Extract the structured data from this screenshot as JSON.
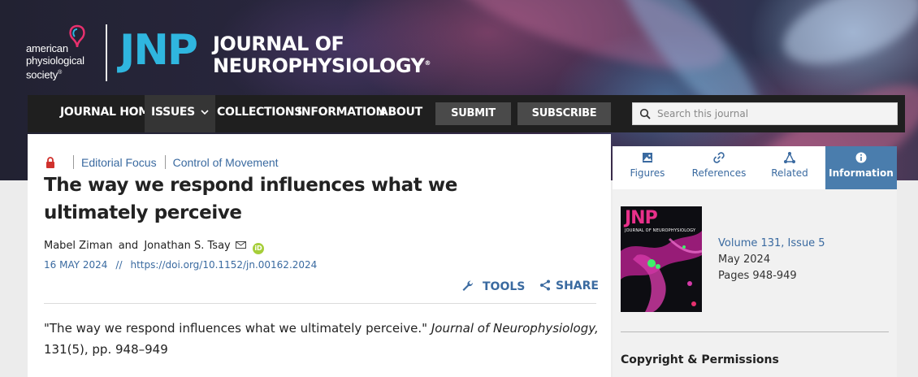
{
  "brand": {
    "aps_lines": [
      "american",
      "physiological",
      "society"
    ],
    "aps_trademark": "®",
    "jnp_abbrev": "JNP",
    "journal_name_line1": "JOURNAL OF",
    "journal_name_line2": "NEUROPHYSIOLOGY",
    "journal_name_trademark": "®"
  },
  "nav": {
    "items": [
      {
        "label": "JOURNAL HOME"
      },
      {
        "label": "ISSUES"
      },
      {
        "label": "COLLECTIONS"
      },
      {
        "label": "INFORMATION"
      },
      {
        "label": "ABOUT"
      }
    ],
    "submit_label": "SUBMIT",
    "subscribe_label": "SUBSCRIBE",
    "search_placeholder": "Search this journal"
  },
  "article": {
    "breadcrumb": [
      "Editorial Focus",
      "Control of Movement"
    ],
    "title": "The way we respond influences what we ultimately perceive",
    "authors": [
      "Mabel Ziman",
      "Jonathan S. Tsay"
    ],
    "and_text": "and",
    "orcid_text": "iD",
    "date": "16 MAY 2024",
    "date_sep": "//",
    "doi": "https://doi.org/10.1152/jn.00162.2024",
    "tools_label": "TOOLS",
    "share_label": "SHARE",
    "citation_quote": "\"The way we respond influences what we ultimately perceive.\"",
    "citation_journal": "Journal of Neurophysiology,",
    "citation_details": "131(5), pp. 948–949"
  },
  "sidebar": {
    "tabs": [
      {
        "label": "Figures",
        "icon": "image-icon"
      },
      {
        "label": "References",
        "icon": "link-icon"
      },
      {
        "label": "Related",
        "icon": "network-icon"
      },
      {
        "label": "Information",
        "icon": "info-icon",
        "active": true
      }
    ],
    "cover": {
      "abbrev": "JNP",
      "subtitle": "JOURNAL OF NEUROPHYSIOLOGY"
    },
    "volume": "Volume 131, Issue 5",
    "month": "May 2024",
    "pages": "Pages 948-949",
    "copyright_heading": "Copyright & Permissions"
  },
  "colors": {
    "accent_blue": "#3a6aa0",
    "jnp_cyan": "#2fb6df",
    "nav_bg": "#1f1f1f",
    "active_tab": "#4a7dad",
    "lock_red": "#d0312d"
  }
}
